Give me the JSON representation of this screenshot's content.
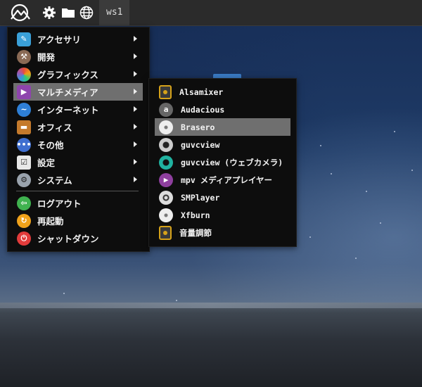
{
  "panel": {
    "workspace": "ws1",
    "icons": [
      "distro-logo-icon",
      "gear-icon",
      "folder-icon",
      "globe-icon"
    ]
  },
  "main_menu": {
    "items": [
      {
        "label": "アクセサリ",
        "icon": "accessories-icon",
        "color": "#3aa0d8",
        "has_submenu": true
      },
      {
        "label": "開発",
        "icon": "hammer-icon",
        "color": "#8a6a55",
        "has_submenu": true
      },
      {
        "label": "グラフィックス",
        "icon": "graphics-icon",
        "color": "#e05a8a",
        "has_submenu": true
      },
      {
        "label": "マルチメディア",
        "icon": "multimedia-icon",
        "color": "#8e44ad",
        "has_submenu": true,
        "selected": true
      },
      {
        "label": "インターネット",
        "icon": "internet-icon",
        "color": "#2e7fd6",
        "has_submenu": true
      },
      {
        "label": "オフィス",
        "icon": "briefcase-icon",
        "color": "#c47a2c",
        "has_submenu": true
      },
      {
        "label": "その他",
        "icon": "more-icon",
        "color": "#3f6fd0",
        "has_submenu": true
      },
      {
        "label": "設定",
        "icon": "settings-icon",
        "color": "#e8e8e8",
        "has_submenu": true
      },
      {
        "label": "システム",
        "icon": "system-icon",
        "color": "#9aa3ad",
        "has_submenu": true
      }
    ],
    "actions": [
      {
        "label": "ログアウト",
        "icon": "logout-icon",
        "color": "#3fb24f"
      },
      {
        "label": "再起動",
        "icon": "restart-icon",
        "color": "#f0a21b"
      },
      {
        "label": "シャットダウン",
        "icon": "shutdown-icon",
        "color": "#e23b3b"
      }
    ]
  },
  "submenu": {
    "items": [
      {
        "label": "Alsamixer",
        "icon": "speaker-icon",
        "color": "#d6a21a"
      },
      {
        "label": "Audacious",
        "icon": "audacious-icon",
        "color": "#666666"
      },
      {
        "label": "Brasero",
        "icon": "disc-burn-icon",
        "color": "#dddddd",
        "selected": true
      },
      {
        "label": "guvcview",
        "icon": "webcam-icon",
        "color": "#cccccc"
      },
      {
        "label": "guvcview (ウェブカメラ)",
        "icon": "webcam-teal-icon",
        "color": "#20b2a0"
      },
      {
        "label": "mpv メディアプレイヤー",
        "icon": "mpv-icon",
        "color": "#8e3f9e"
      },
      {
        "label": "SMPlayer",
        "icon": "film-reel-icon",
        "color": "#dddddd"
      },
      {
        "label": "Xfburn",
        "icon": "disc-burn-icon",
        "color": "#dddddd"
      },
      {
        "label": "音量調節",
        "icon": "speaker-icon",
        "color": "#d6a21a"
      }
    ]
  }
}
